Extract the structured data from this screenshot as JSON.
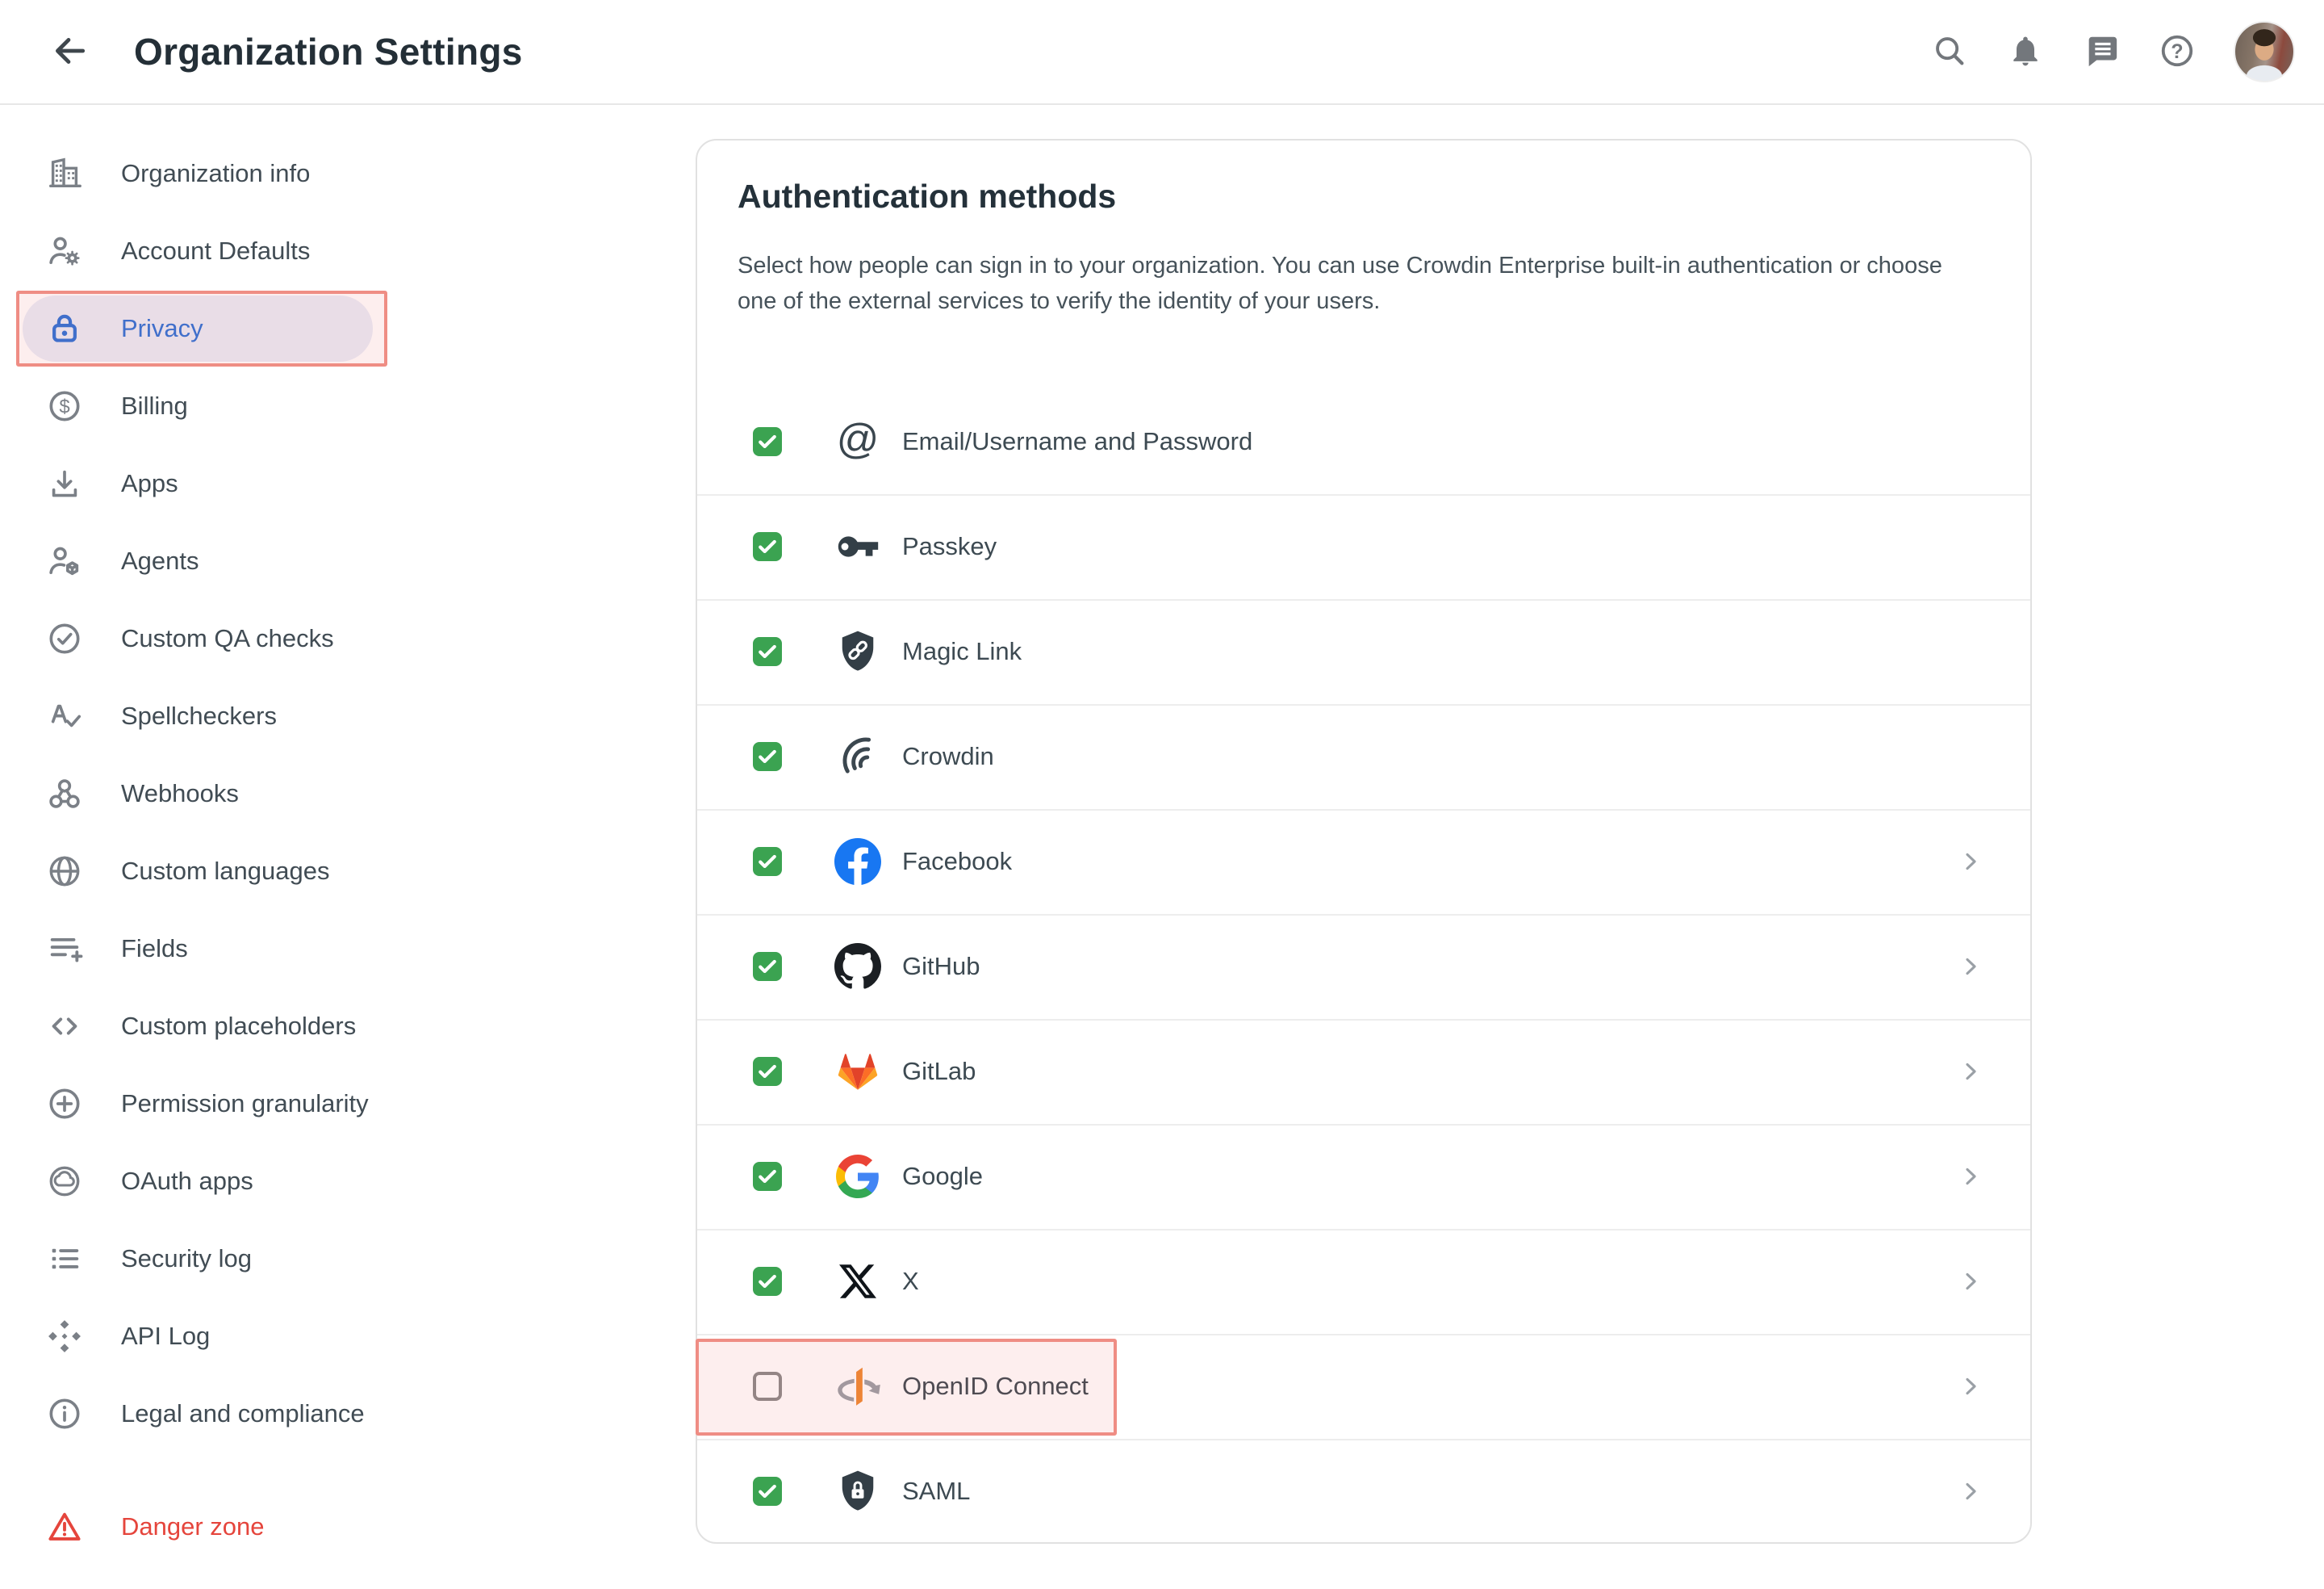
{
  "header": {
    "title": "Organization Settings",
    "back_icon": "back-arrow",
    "actions": [
      {
        "id": "search",
        "icon": "search"
      },
      {
        "id": "notifications",
        "icon": "bell"
      },
      {
        "id": "messages",
        "icon": "chat"
      },
      {
        "id": "help",
        "icon": "help"
      }
    ],
    "avatar": {
      "id": "user-avatar"
    }
  },
  "sidebar": {
    "items": [
      {
        "id": "organization-info",
        "label": "Organization info",
        "icon": "building",
        "active": false,
        "danger": false
      },
      {
        "id": "account-defaults",
        "label": "Account Defaults",
        "icon": "person-gear",
        "active": false,
        "danger": false
      },
      {
        "id": "privacy",
        "label": "Privacy",
        "icon": "lock",
        "active": true,
        "danger": false
      },
      {
        "id": "billing",
        "label": "Billing",
        "icon": "dollar-circle",
        "active": false,
        "danger": false
      },
      {
        "id": "apps",
        "label": "Apps",
        "icon": "download",
        "active": false,
        "danger": false
      },
      {
        "id": "agents",
        "label": "Agents",
        "icon": "person-cube",
        "active": false,
        "danger": false
      },
      {
        "id": "custom-qa-checks",
        "label": "Custom QA checks",
        "icon": "check-circle",
        "active": false,
        "danger": false
      },
      {
        "id": "spellcheckers",
        "label": "Spellcheckers",
        "icon": "spellcheck",
        "active": false,
        "danger": false
      },
      {
        "id": "webhooks",
        "label": "Webhooks",
        "icon": "webhook",
        "active": false,
        "danger": false
      },
      {
        "id": "custom-languages",
        "label": "Custom languages",
        "icon": "globe",
        "active": false,
        "danger": false
      },
      {
        "id": "fields",
        "label": "Fields",
        "icon": "fields",
        "active": false,
        "danger": false
      },
      {
        "id": "custom-placeholders",
        "label": "Custom placeholders",
        "icon": "code-brackets",
        "active": false,
        "danger": false
      },
      {
        "id": "permission-granularity",
        "label": "Permission granularity",
        "icon": "circle-plus",
        "active": false,
        "danger": false
      },
      {
        "id": "oauth-apps",
        "label": "OAuth apps",
        "icon": "cloud-circle",
        "active": false,
        "danger": false
      },
      {
        "id": "security-log",
        "label": "Security log",
        "icon": "list-bullets",
        "active": false,
        "danger": false
      },
      {
        "id": "api-log",
        "label": "API Log",
        "icon": "api-diamonds",
        "active": false,
        "danger": false
      },
      {
        "id": "legal-and-compliance",
        "label": "Legal and compliance",
        "icon": "info-circle",
        "active": false,
        "danger": false
      },
      {
        "id": "danger-zone",
        "label": "Danger zone",
        "icon": "warning-triangle",
        "active": false,
        "danger": true
      }
    ]
  },
  "card": {
    "title": "Authentication methods",
    "description": "Select how people can sign in to your organization. You can use Crowdin Enterprise built-in authentication or choose one of the external services to verify the identity of your users.",
    "methods": [
      {
        "id": "email-username-password",
        "label": "Email/Username and Password",
        "icon": "at-sign",
        "checked": true,
        "chevron": false,
        "highlighted": false
      },
      {
        "id": "passkey",
        "label": "Passkey",
        "icon": "passkey-key",
        "checked": true,
        "chevron": false,
        "highlighted": false
      },
      {
        "id": "magic-link",
        "label": "Magic Link",
        "icon": "shield-link",
        "checked": true,
        "chevron": false,
        "highlighted": false
      },
      {
        "id": "crowdin",
        "label": "Crowdin",
        "icon": "crowdin",
        "checked": true,
        "chevron": false,
        "highlighted": false
      },
      {
        "id": "facebook",
        "label": "Facebook",
        "icon": "facebook",
        "checked": true,
        "chevron": true,
        "highlighted": false
      },
      {
        "id": "github",
        "label": "GitHub",
        "icon": "github",
        "checked": true,
        "chevron": true,
        "highlighted": false
      },
      {
        "id": "gitlab",
        "label": "GitLab",
        "icon": "gitlab",
        "checked": true,
        "chevron": true,
        "highlighted": false
      },
      {
        "id": "google",
        "label": "Google",
        "icon": "google",
        "checked": true,
        "chevron": true,
        "highlighted": false
      },
      {
        "id": "x",
        "label": "X",
        "icon": "x-logo",
        "checked": true,
        "chevron": true,
        "highlighted": false
      },
      {
        "id": "openid-connect",
        "label": "OpenID Connect",
        "icon": "openid",
        "checked": false,
        "chevron": true,
        "highlighted": true
      },
      {
        "id": "saml",
        "label": "SAML",
        "icon": "saml-shield",
        "checked": true,
        "chevron": true,
        "highlighted": false
      }
    ]
  },
  "colors": {
    "accent_blue": "#2D72D8",
    "checkbox_green": "#3BA351",
    "danger_red": "#E5453C",
    "annotation_border": "#EF8D84",
    "openid_orange": "#EE8A33"
  }
}
